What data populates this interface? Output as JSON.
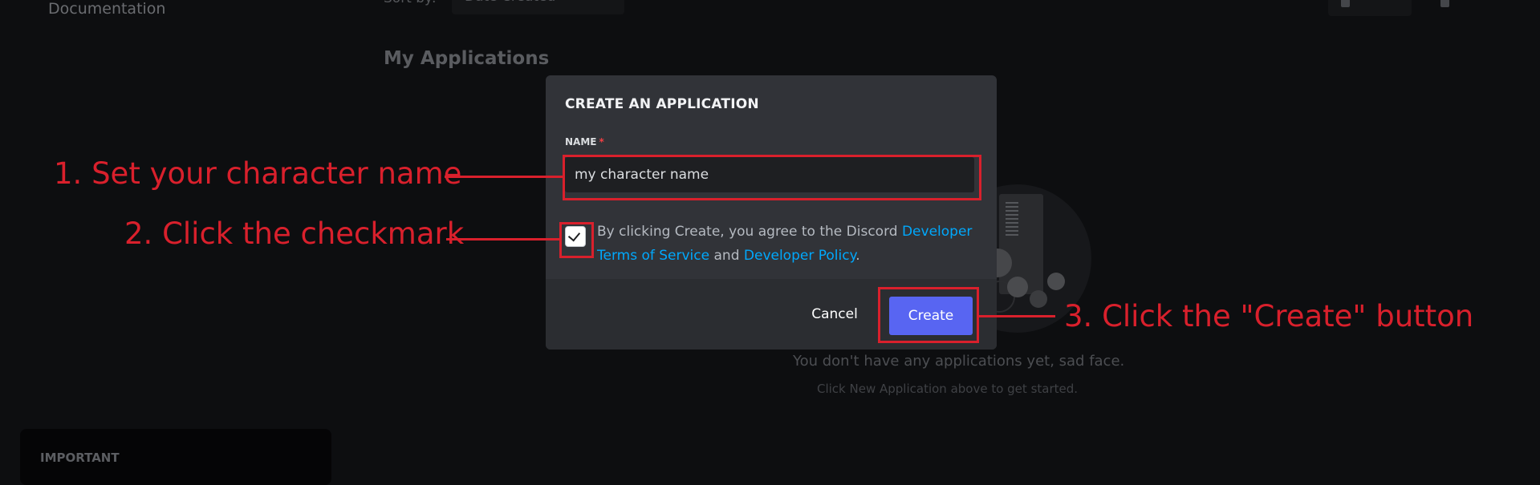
{
  "background": {
    "sidebar_link": "Documentation",
    "sort_label": "Sort by:",
    "sort_value": "Date Created",
    "page_heading": "My Applications",
    "empty_title": "You don't have any applications yet, sad face.",
    "empty_subtitle": "Click New Application above to get started.",
    "important_label": "IMPORTANT"
  },
  "modal": {
    "title": "CREATE AN APPLICATION",
    "name_label": "NAME",
    "required_mark": "*",
    "name_value": "my character name",
    "checkbox_checked": true,
    "agree_prefix": "By clicking Create, you agree to the Discord ",
    "terms_link": "Developer Terms of Service",
    "agree_middle": " and ",
    "policy_link": "Developer Policy",
    "agree_suffix": ".",
    "cancel_label": "Cancel",
    "create_label": "Create"
  },
  "annotations": {
    "step1": "1. Set your character name",
    "step2": "2. Click the checkmark",
    "step3": "3. Click the \"Create\" button"
  },
  "colors": {
    "annotation_red": "#d9202c",
    "brand_blurple": "#5865f2",
    "link_blue": "#00a8fc",
    "modal_bg": "#313338"
  }
}
